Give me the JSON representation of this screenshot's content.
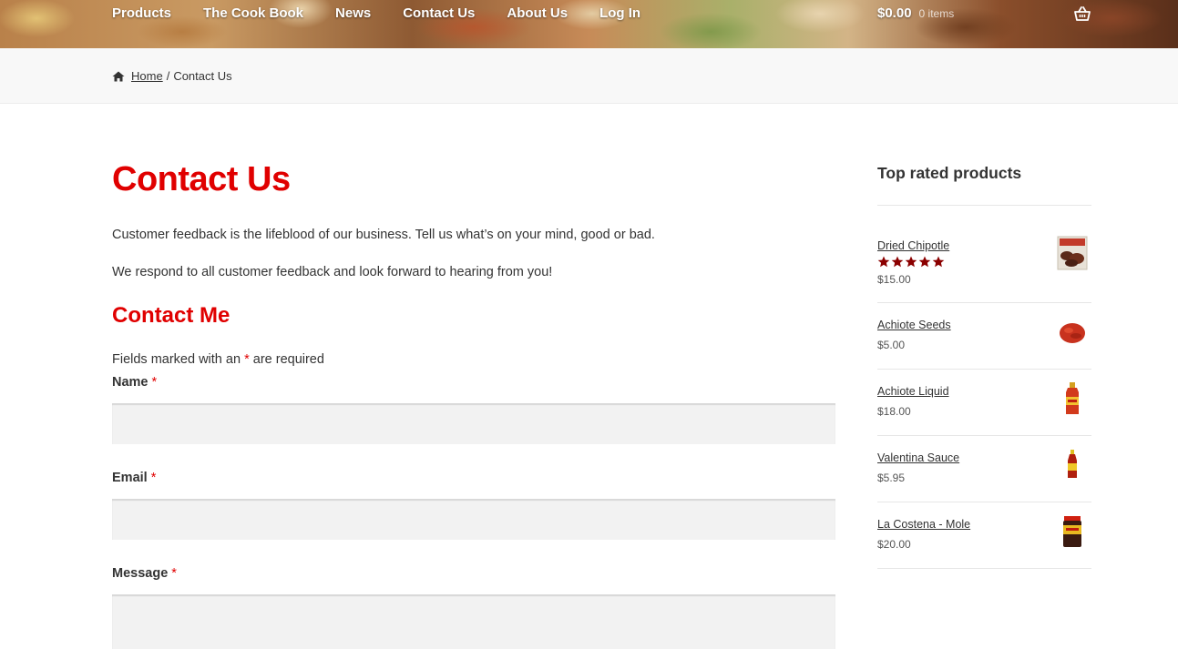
{
  "nav": {
    "items": [
      "Products",
      "The Cook Book",
      "News",
      "Contact Us",
      "About Us",
      "Log In"
    ]
  },
  "cart": {
    "total": "$0.00",
    "count": "0 items",
    "icon": "basket-icon"
  },
  "breadcrumb": {
    "home": "Home",
    "separator": "/",
    "current": "Contact Us"
  },
  "page": {
    "title": "Contact Us",
    "intro_1": "Customer feedback is the lifeblood of our business. Tell us what’s on your mind, good or bad.",
    "intro_2": "We respond to all customer feedback and look forward to hearing from you!"
  },
  "form": {
    "title": "Contact Me",
    "required_note_before": "Fields marked with an",
    "required_marker": "*",
    "required_note_after": "are required",
    "name_label": "Name",
    "email_label": "Email",
    "message_label": "Message",
    "name_value": "",
    "email_value": "",
    "message_value": ""
  },
  "sidebar": {
    "title": "Top rated products",
    "products": [
      {
        "name": "Dried Chipotle",
        "price": "$15.00",
        "rating": 5,
        "thumb": "dried-chipotle-thumbnail"
      },
      {
        "name": "Achiote Seeds",
        "price": "$5.00",
        "thumb": "achiote-seeds-thumbnail"
      },
      {
        "name": "Achiote Liquid",
        "price": "$18.00",
        "thumb": "achiote-liquid-thumbnail"
      },
      {
        "name": "Valentina Sauce",
        "price": "$5.95",
        "thumb": "valentina-sauce-thumbnail"
      },
      {
        "name": "La Costena - Mole",
        "price": "$20.00",
        "thumb": "mole-jar-thumbnail"
      }
    ]
  },
  "colors": {
    "accent_red": "#e00000",
    "star_color": "#8b0000",
    "text": "#333333",
    "breadcrumb_bg": "#f8f8f8",
    "input_bg": "#f2f2f2"
  }
}
